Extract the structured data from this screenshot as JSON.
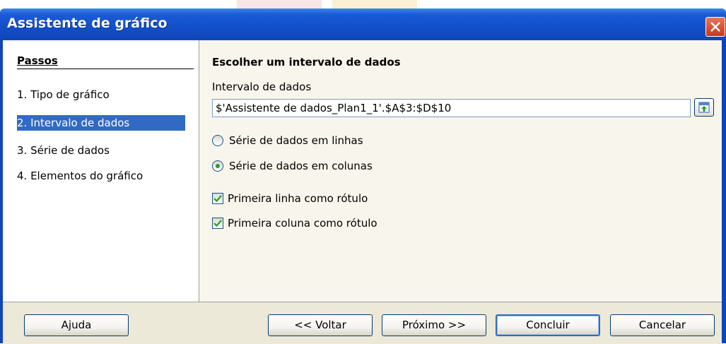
{
  "window": {
    "title": "Assistente de gráfico"
  },
  "steps": {
    "title": "Passos",
    "items": [
      {
        "label": "1. Tipo de gráfico",
        "selected": false
      },
      {
        "label": "2. Intervalo de dados",
        "selected": true
      },
      {
        "label": "3. Série de dados",
        "selected": false
      },
      {
        "label": "4. Elementos do gráfico",
        "selected": false
      }
    ]
  },
  "content": {
    "title": "Escolher um intervalo de dados",
    "range_label": "Intervalo de dados",
    "range_value": "$'Assistente de dados_Plan1_1'.$A$3:$D$10",
    "radio_rows": "Série de dados em linhas",
    "radio_columns": "Série de dados em colunas",
    "radio_selected": "columns",
    "check_first_row": "Primeira linha como rótulo",
    "check_first_col": "Primeira coluna como rótulo",
    "check_first_row_checked": true,
    "check_first_col_checked": true
  },
  "buttons": {
    "help": "Ajuda",
    "back": "<< Voltar",
    "next": "Próximo >>",
    "finish": "Concluir",
    "cancel": "Cancelar"
  },
  "colors": {
    "titlebar": "#1350cc",
    "selection": "#316ac5",
    "checkmark": "#21a121"
  }
}
